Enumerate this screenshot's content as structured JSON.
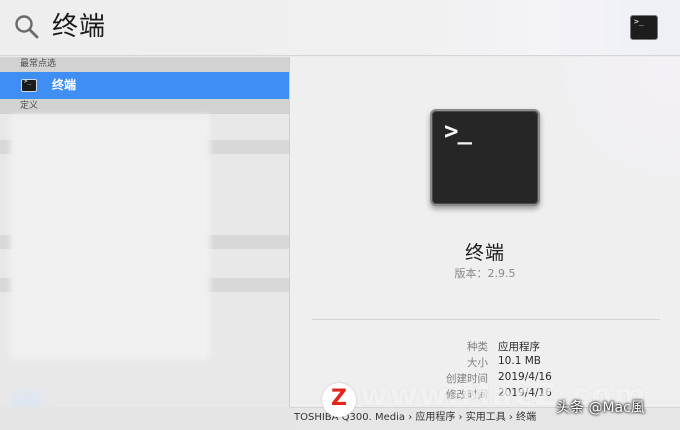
{
  "search": {
    "query": "终端",
    "top_result_icon": "terminal-icon",
    "top_result_glyph": ">_"
  },
  "list": {
    "sections": [
      {
        "title": "最常点选"
      },
      {
        "title": "定义"
      }
    ],
    "top_hit": {
      "label": "终端",
      "icon": "terminal-icon",
      "glyph": ">_"
    },
    "colors": {
      "selected": "#3f8ef4"
    }
  },
  "detail": {
    "icon": "terminal-app-icon",
    "glyph": ">_",
    "name": "终端",
    "version": "版本：2.9.5",
    "meta": [
      {
        "key": "种类",
        "value": "应用程序"
      },
      {
        "key": "大小",
        "value": "10.1 MB"
      },
      {
        "key": "创建时间",
        "value": "2019/4/16"
      },
      {
        "key": "修改时间",
        "value": "2019/4/16"
      }
    ]
  },
  "pathbar": {
    "text": "TOSHIBA Q300. Media › 应用程序 › 实用工具 › 终端"
  },
  "watermark": {
    "logo_letter": "Z",
    "site": "www.MacZ.com",
    "credit": "头条 @Mac風"
  }
}
